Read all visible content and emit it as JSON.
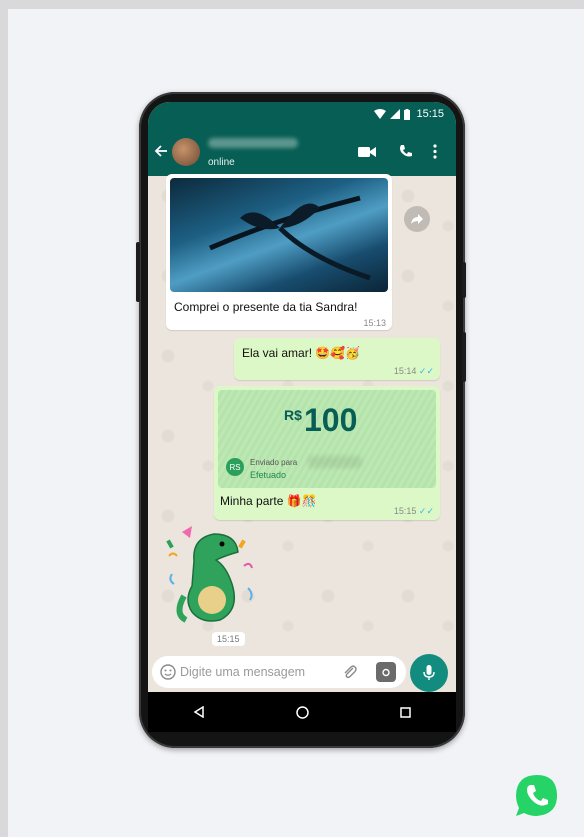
{
  "status_bar": {
    "time": "15:15"
  },
  "header": {
    "status": "online"
  },
  "messages": {
    "image_caption": "Comprei o presente da tia Sandra!",
    "image_time": "15:13",
    "out1_text": "Ela vai amar! 🤩🥰🥳",
    "out1_time": "15:14",
    "payment_currency": "R$",
    "payment_amount": "100",
    "payment_avatar": "RS",
    "payment_sent_to": "Enviado para",
    "payment_status": "Efetuado",
    "payment_caption": "Minha parte 🎁🎊",
    "payment_time": "15:15",
    "sticker_time": "15:15"
  },
  "input": {
    "placeholder": "Digite uma mensagem"
  },
  "colors": {
    "header": "#075e54",
    "outgoing_bubble": "#dcf8c6",
    "accent": "#25d366",
    "send_button": "#128c7e",
    "read_ticks": "#34b7f1"
  },
  "icons": [
    "back-arrow-icon",
    "video-call-icon",
    "phone-call-icon",
    "more-menu-icon",
    "forward-icon",
    "emoji-icon",
    "attach-icon",
    "camera-icon",
    "mic-icon",
    "nav-back-icon",
    "nav-home-icon",
    "nav-recent-icon",
    "whatsapp-logo-icon"
  ]
}
